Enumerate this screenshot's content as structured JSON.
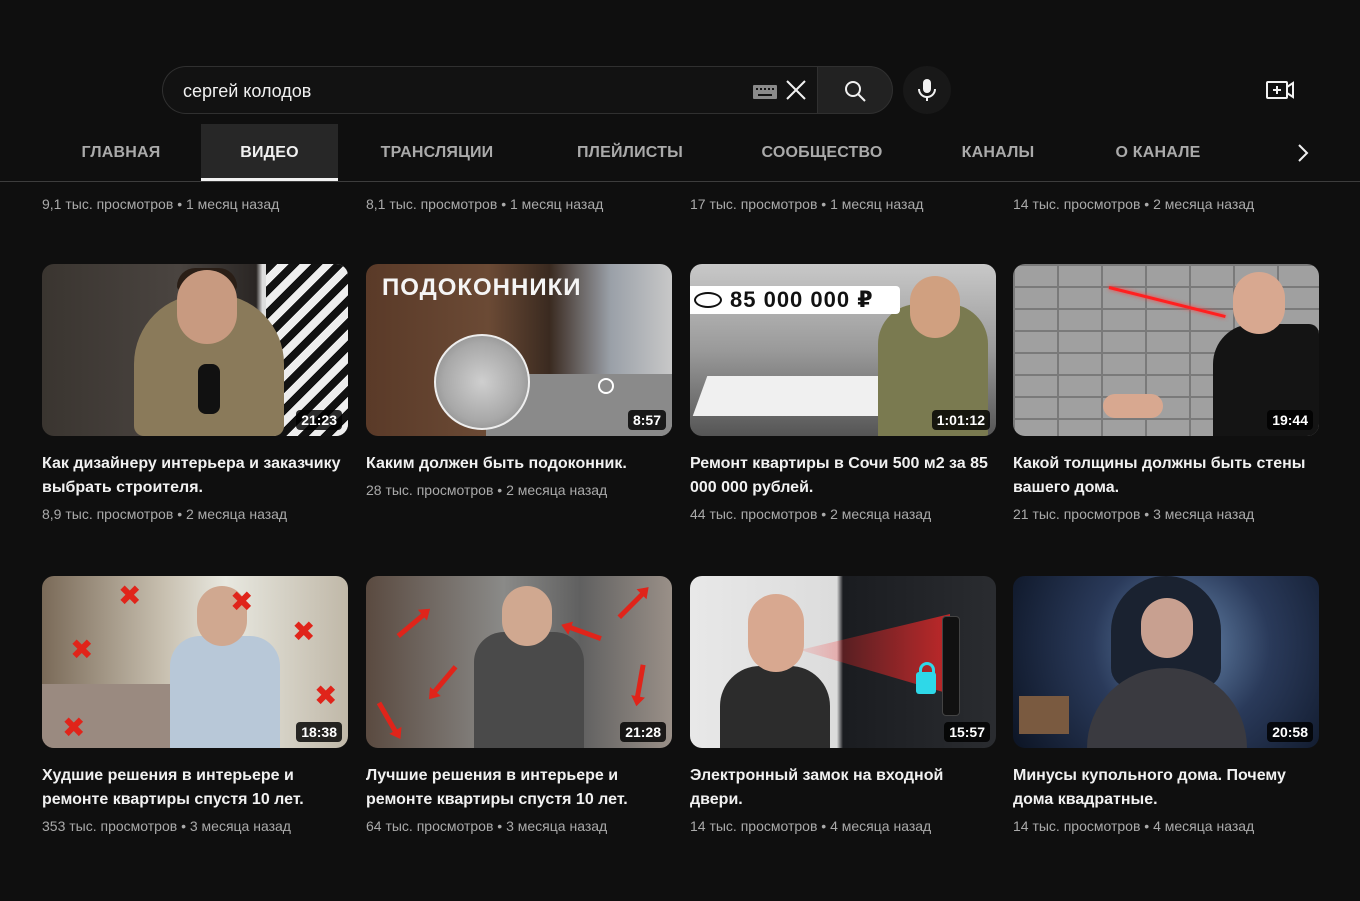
{
  "search": {
    "value": "сергей колодов"
  },
  "tabs": [
    "ГЛАВНАЯ",
    "ВИДЕО",
    "ТРАНСЛЯЦИИ",
    "ПЛЕЙЛИСТЫ",
    "СООБЩЕСТВО",
    "КАНАЛЫ",
    "О КАНАЛЕ"
  ],
  "active_tab": "ВИДЕО",
  "previous_row": [
    {
      "views": "9,1 тыс. просмотров",
      "age": "1 месяц назад"
    },
    {
      "views": "8,1 тыс. просмотров",
      "age": "1 месяц назад"
    },
    {
      "views": "17 тыс. просмотров",
      "age": "1 месяц назад"
    },
    {
      "views": "14 тыс. просмотров",
      "age": "2 месяца назад"
    }
  ],
  "videos": [
    {
      "title": "Как дизайнеру интерьера и заказчику выбрать строителя.",
      "views": "8,9 тыс. просмотров",
      "age": "2 месяца назад",
      "duration": "21:23"
    },
    {
      "title": "Каким должен быть подоконник.",
      "views": "28 тыс. просмотров",
      "age": "2 месяца назад",
      "duration": "8:57",
      "thumb_text": "ПОДОКОННИКИ"
    },
    {
      "title": "Ремонт квартиры в Сочи 500 м2 за 85 000 000 рублей.",
      "views": "44 тыс. просмотров",
      "age": "2 месяца назад",
      "duration": "1:01:12",
      "thumb_text": "85 000 000 ₽"
    },
    {
      "title": "Какой толщины должны быть стены вашего дома.",
      "views": "21 тыс. просмотров",
      "age": "3 месяца назад",
      "duration": "19:44"
    },
    {
      "title": "Худшие решения в интерьере и ремонте квартиры спустя 10 лет.",
      "views": "353 тыс. просмотров",
      "age": "3 месяца назад",
      "duration": "18:38"
    },
    {
      "title": "Лучшие решения в интерьере и ремонте квартиры спустя 10 лет.",
      "views": "64 тыс. просмотров",
      "age": "3 месяца назад",
      "duration": "21:28"
    },
    {
      "title": "Электронный замок на входной двери.",
      "views": "14 тыс. просмотров",
      "age": "4 месяца назад",
      "duration": "15:57"
    },
    {
      "title": "Минусы купольного дома. Почему дома квадратные.",
      "views": "14 тыс. просмотров",
      "age": "4 месяца назад",
      "duration": "20:58"
    }
  ],
  "meta_separator": "•",
  "colors": {
    "background": "#0f0f0f",
    "text": "#f1f1f1",
    "secondary": "#aaaaaa",
    "accent_red": "#e0241a"
  }
}
